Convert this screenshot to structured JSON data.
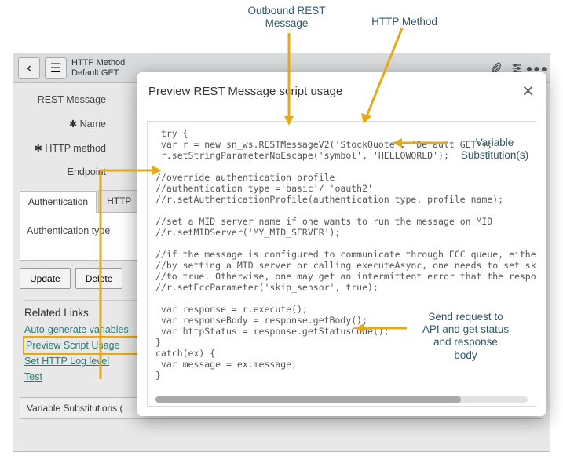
{
  "annotations": {
    "outbound": "Outbound REST\nMessage",
    "httpMethod": "HTTP Method",
    "varSub": "Variable\nSubstitution(s)",
    "sendReq": "Send request to\nAPI and get status\nand response\nbody"
  },
  "header": {
    "title_top": "HTTP Method",
    "title_sub": "Default GET"
  },
  "form": {
    "restMessageLabel": "REST Message",
    "nameLabel": "Name",
    "httpMethodLabel": "HTTP method",
    "endpointLabel": "Endpoint"
  },
  "tabs": {
    "auth": "Authentication",
    "http": "HTTP"
  },
  "authTypeLabel": "Authentication type",
  "buttons": {
    "update": "Update",
    "delete": "Delete"
  },
  "relatedLinks": {
    "title": "Related Links",
    "items": [
      "Auto-generate variables",
      "Preview Script Usage",
      "Set HTTP Log level",
      "Test"
    ]
  },
  "varSubSection": "Variable Substitutions (",
  "modal": {
    "title": "Preview REST Message script usage",
    "code": " try {\n var r = new sn_ws.RESTMessageV2('StockQuote', 'Default GET');\n r.setStringParameterNoEscape('symbol', 'HELLOWORLD');\n\n//override authentication profile\n//authentication type ='basic'/ 'oauth2'\n//r.setAuthenticationProfile(authentication type, profile name);\n\n//set a MID server name if one wants to run the message on MID\n//r.setMIDServer('MY_MID_SERVER');\n\n//if the message is configured to communicate through ECC queue, either\n//by setting a MID server or calling executeAsync, one needs to set skip_sen\n//to true. Otherwise, one may get an intermittent error that the response bo\n//r.setEccParameter('skip_sensor', true);\n\n var response = r.execute();\n var responseBody = response.getBody();\n var httpStatus = response.getStatusCode();\n}\ncatch(ex) {\n var message = ex.message;\n}"
  }
}
